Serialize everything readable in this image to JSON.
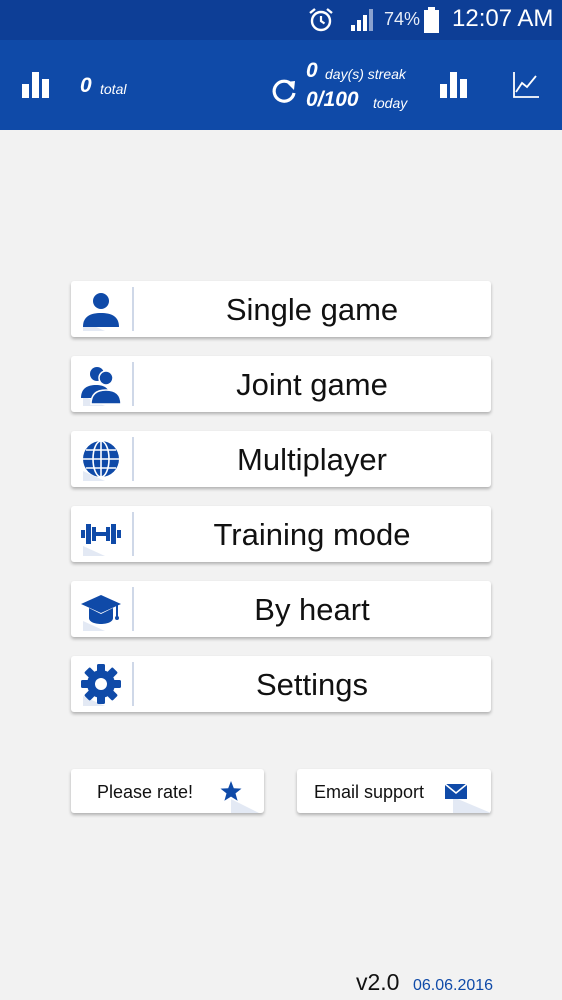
{
  "status_bar": {
    "battery": "74%",
    "time": "12:07 AM",
    "icons": [
      "alarm-icon",
      "signal-icon",
      "battery-icon"
    ]
  },
  "toolbar": {
    "total_count": "0",
    "total_label": "total",
    "streak_count": "0",
    "streak_label": "day(s) streak",
    "today_count": "0/100",
    "today_label": "today",
    "icons": [
      "bar-chart-icon",
      "refresh-icon",
      "bar-chart-icon",
      "line-chart-icon"
    ]
  },
  "menu": [
    {
      "label": "Single game",
      "icon": "person-icon"
    },
    {
      "label": "Joint game",
      "icon": "people-icon"
    },
    {
      "label": "Multiplayer",
      "icon": "globe-icon"
    },
    {
      "label": "Training mode",
      "icon": "dumbbell-icon"
    },
    {
      "label": "By heart",
      "icon": "graduation-cap-icon"
    },
    {
      "label": "Settings",
      "icon": "gear-icon"
    }
  ],
  "actions": {
    "rate_label": "Please rate!",
    "email_label": "Email support",
    "icons": [
      "star-icon",
      "envelope-icon"
    ]
  },
  "footer": {
    "version": "v2.0",
    "date": "06.06.2016"
  },
  "colors": {
    "primary": "#0f4aa8",
    "statusbar": "#0d3e96",
    "background": "#f2f2f2",
    "icon": "#0f4aa8"
  }
}
